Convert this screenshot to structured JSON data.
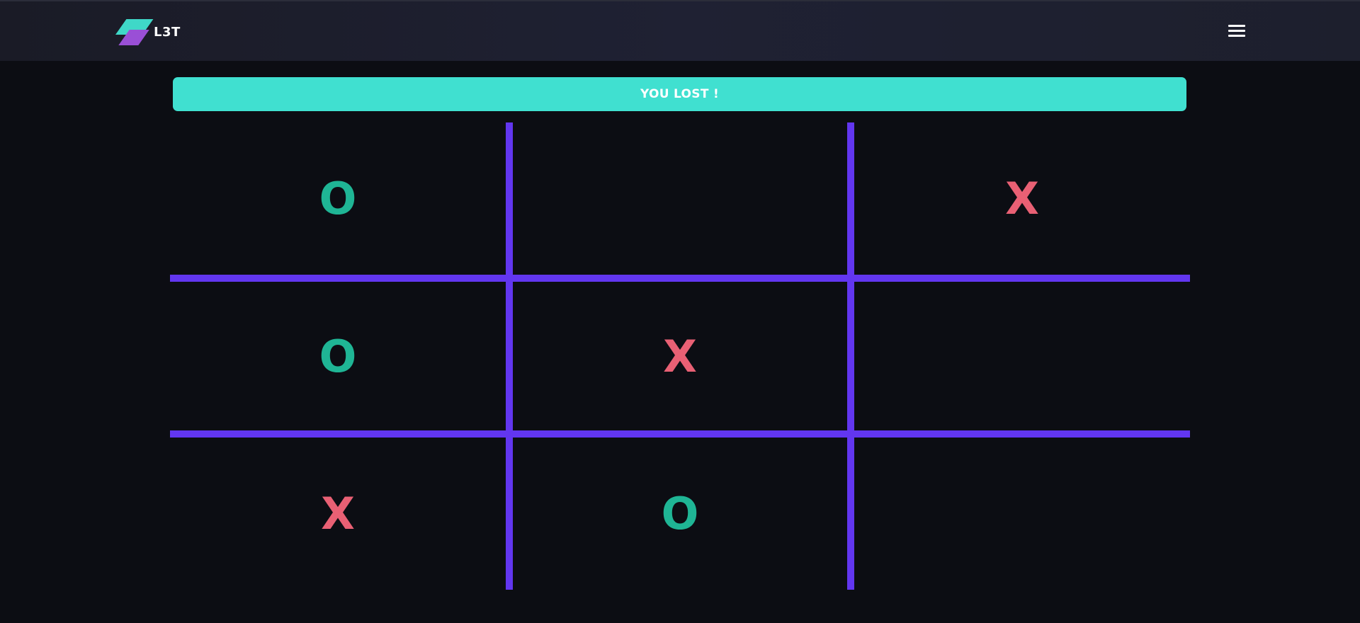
{
  "navbar": {
    "brand_name": "L3T",
    "logo_icon": "l3t-logo-icon",
    "menu_icon": "hamburger-menu-icon"
  },
  "status": {
    "message": "YOU LOST !"
  },
  "board": {
    "cells": [
      "O",
      "",
      "X",
      "O",
      "X",
      "",
      "X",
      "O",
      ""
    ]
  },
  "colors": {
    "background": "#0c0d13",
    "navbar": "#1f2133",
    "banner": "#40e0d0",
    "grid_lines": "#6236f0",
    "o_mark": "#1fb595",
    "x_mark": "#e96074",
    "logo_teal": "#3fd8c8",
    "logo_purple": "#9a4fd6"
  }
}
